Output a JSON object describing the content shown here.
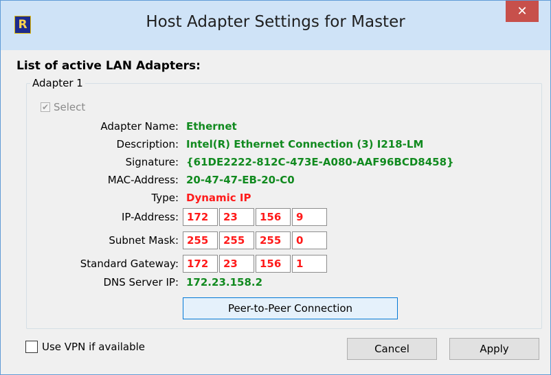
{
  "window": {
    "title": "Host Adapter Settings for Master",
    "icon": "R",
    "close_glyph": "✕"
  },
  "heading": "List of active LAN Adapters:",
  "adapter": {
    "group_title": "Adapter 1",
    "select_label": "Select",
    "select_checked": true,
    "fields": {
      "name_label": "Adapter Name:",
      "name_value": "Ethernet",
      "description_label": "Description:",
      "description_value": "Intel(R) Ethernet Connection (3) I218-LM",
      "signature_label": "Signature:",
      "signature_value": "{61DE2222-812C-473E-A080-AAF96BCD8458}",
      "mac_label": "MAC-Address:",
      "mac_value": "20-47-47-EB-20-C0",
      "type_label": "Type:",
      "type_value": "Dynamic IP",
      "ip_label": "IP-Address:",
      "ip_octets": [
        "172",
        "23",
        "156",
        "9"
      ],
      "subnet_label": "Subnet Mask:",
      "subnet_octets": [
        "255",
        "255",
        "255",
        "0"
      ],
      "gateway_label": "Standard Gateway:",
      "gateway_octets": [
        "172",
        "23",
        "156",
        "1"
      ],
      "dns_label": "DNS Server IP:",
      "dns_value": "172.23.158.2"
    },
    "p2p_button": "Peer-to-Peer Connection"
  },
  "footer": {
    "vpn_label": "Use VPN if available",
    "vpn_checked": false,
    "cancel_label": "Cancel",
    "apply_label": "Apply"
  },
  "colors": {
    "value_green": "#118a1f",
    "value_red": "#ff1a1a",
    "titlebar": "#cfe3f7",
    "close_button": "#c7504b"
  }
}
